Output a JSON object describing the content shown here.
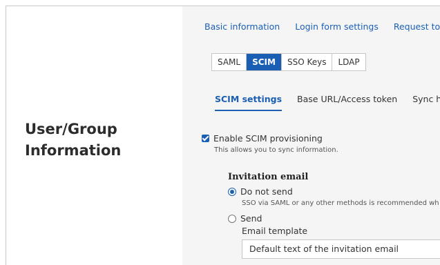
{
  "left_panel": {
    "title_line1": "User/Group",
    "title_line2": "Information"
  },
  "top_links": [
    "Basic information",
    "Login form settings",
    "Request to cha"
  ],
  "protocol_tabs": [
    {
      "label": "SAML",
      "active": false
    },
    {
      "label": "SCIM",
      "active": true
    },
    {
      "label": "SSO Keys",
      "active": false
    },
    {
      "label": "LDAP",
      "active": false
    }
  ],
  "sub_tabs": [
    {
      "label": "SCIM settings",
      "active": true
    },
    {
      "label": "Base URL/Access token",
      "active": false
    },
    {
      "label": "Sync hist",
      "active": false
    }
  ],
  "scim": {
    "checkbox_label": "Enable SCIM provisioning",
    "checkbox_checked": true,
    "checkbox_hint": "This allows you to sync information."
  },
  "invitation": {
    "title": "Invitation email",
    "option_do_not_send": "Do not send",
    "option_do_not_send_hint": "SSO via SAML or any other methods is recommended wh",
    "option_send": "Send",
    "selected": "Do not send",
    "template_label": "Email template",
    "template_value": "Default text of the invitation email"
  },
  "colors": {
    "accent": "#1a5fb4",
    "panel_bg": "#f5f5f5",
    "border": "#c6c6c6"
  }
}
